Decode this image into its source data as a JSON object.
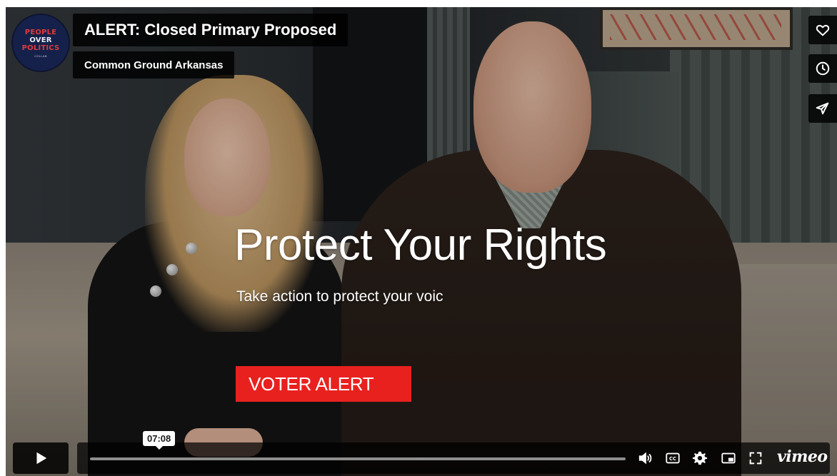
{
  "video": {
    "title": "ALERT: Closed Primary Proposed",
    "byline": "Common Ground Arkansas",
    "logo": {
      "line1": "PEOPLE",
      "line2": "OVER",
      "line3": "POLITICS",
      "tiny": "COLLAB"
    },
    "overlay": {
      "headline": "Protect Your Rights",
      "subtext": "Take action to protect your voic",
      "cta_label": "VOTER ALERT",
      "cta_color": "#e8211f"
    }
  },
  "side_actions": {
    "like_icon": "heart-icon",
    "watch_later_icon": "clock-icon",
    "share_icon": "paper-plane-icon"
  },
  "controls": {
    "time_tooltip": "07:08",
    "progress_fraction": 0.0,
    "play_icon": "play-icon",
    "volume_icon": "volume-icon",
    "captions_icon": "cc-icon",
    "settings_icon": "gear-icon",
    "pip_icon": "picture-in-picture-icon",
    "fullscreen_icon": "fullscreen-icon",
    "brand": "vimeo"
  }
}
